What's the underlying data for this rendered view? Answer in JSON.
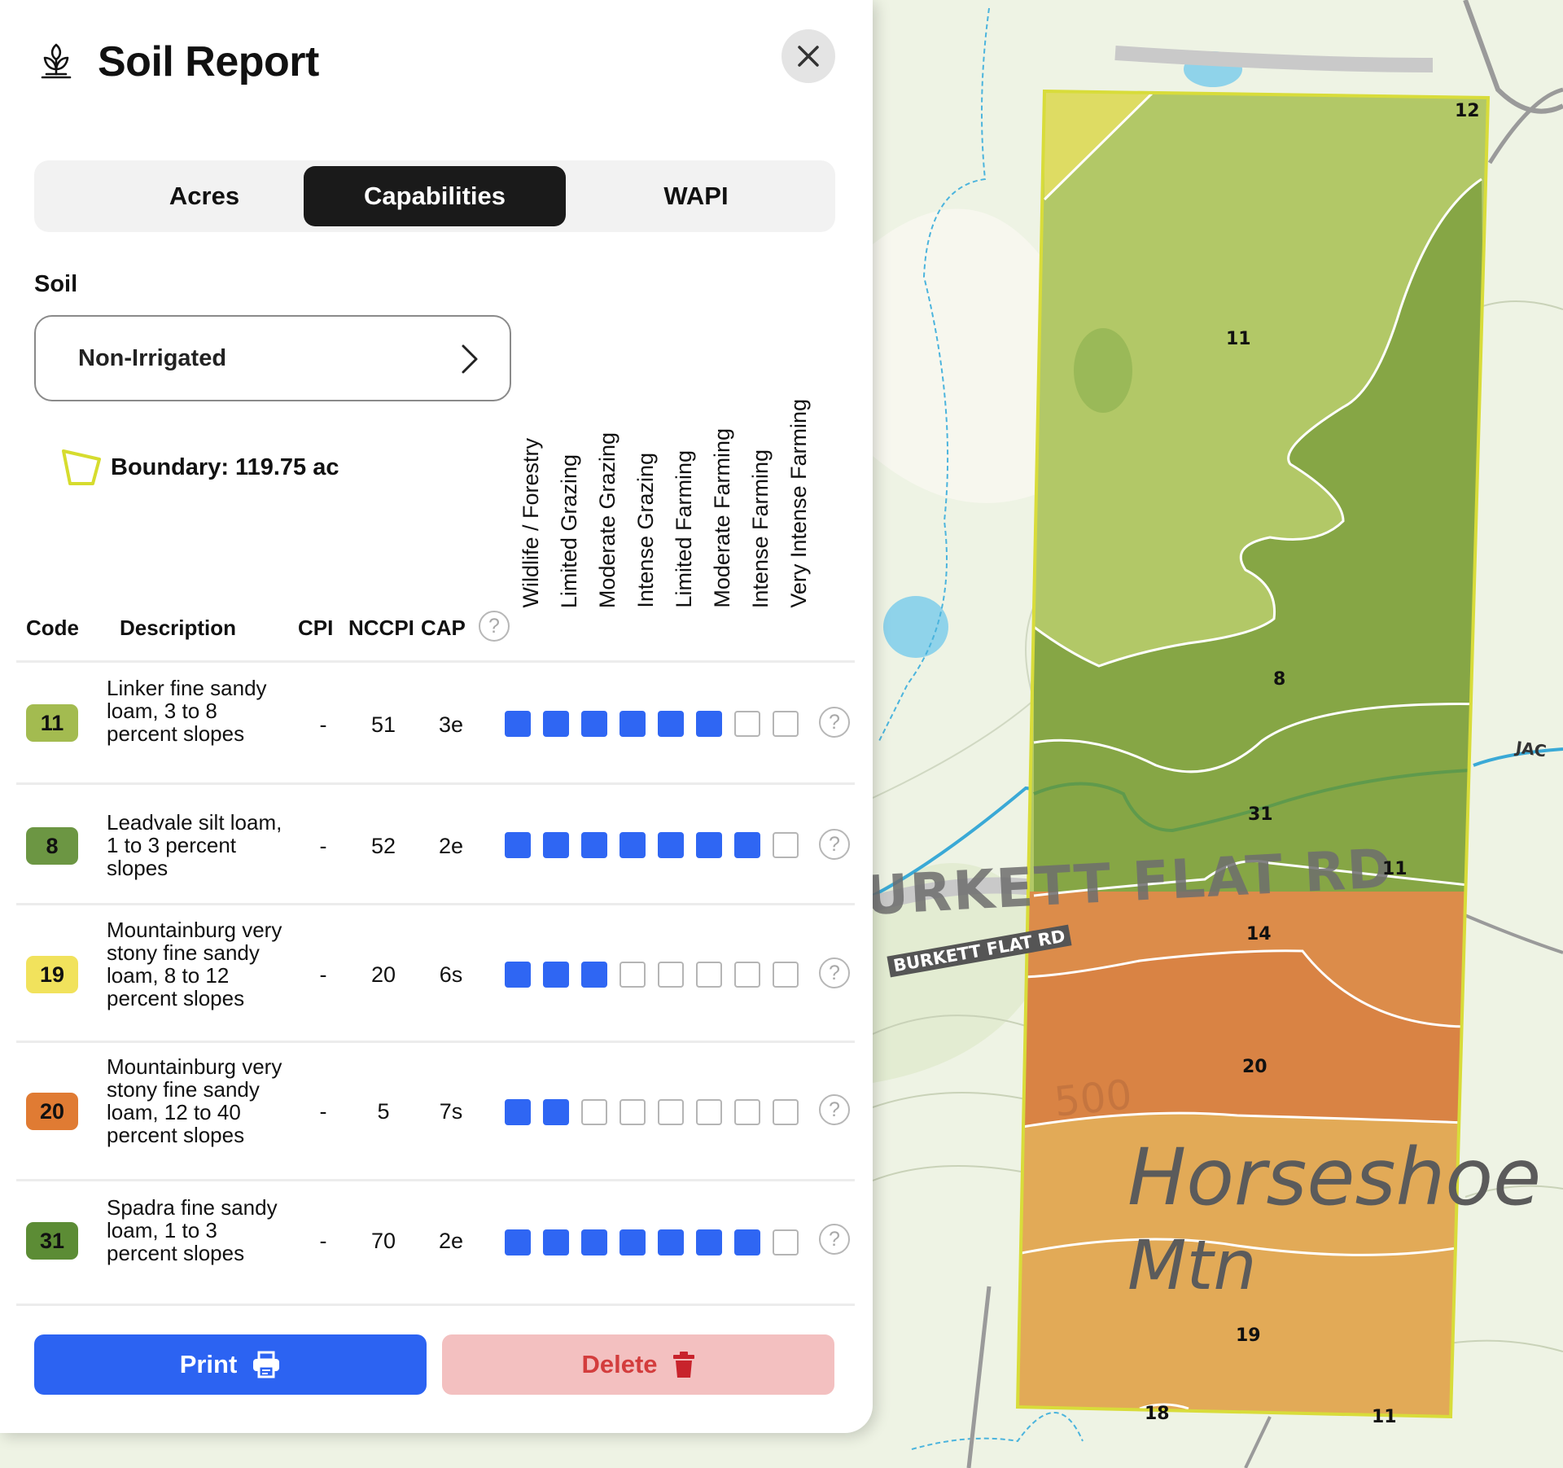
{
  "header": {
    "title": "Soil Report"
  },
  "tabs": [
    {
      "label": "Acres",
      "active": false
    },
    {
      "label": "Capabilities",
      "active": true
    },
    {
      "label": "WAPI",
      "active": false
    }
  ],
  "soil": {
    "label": "Soil",
    "selected": "Non-Irrigated"
  },
  "boundary": {
    "label": "Boundary: 119.75 ac"
  },
  "table": {
    "headers": {
      "code": "Code",
      "description": "Description",
      "cpi": "CPI",
      "nccpi": "NCCPI",
      "cap": "CAP"
    },
    "capability_columns": [
      "Wildlife / Forestry",
      "Limited Grazing",
      "Moderate Grazing",
      "Intense Grazing",
      "Limited Farming",
      "Moderate Farming",
      "Intense Farming",
      "Very Intense Farming"
    ],
    "rows": [
      {
        "code": "11",
        "color": "#a3bb50",
        "description": "Linker fine sandy loam, 3 to 8 percent slopes",
        "cpi": "-",
        "nccpi": "51",
        "cap": "3e",
        "capability_level": 6
      },
      {
        "code": "8",
        "color": "#6c9643",
        "description": "Leadvale silt loam, 1 to 3 percent slopes",
        "cpi": "-",
        "nccpi": "52",
        "cap": "2e",
        "capability_level": 7
      },
      {
        "code": "19",
        "color": "#f1e25c",
        "description": "Mountainburg very stony fine sandy loam, 8 to 12 percent slopes",
        "cpi": "-",
        "nccpi": "20",
        "cap": "6s",
        "capability_level": 3
      },
      {
        "code": "20",
        "color": "#e07b33",
        "description": "Mountainburg very stony fine sandy loam, 12 to 40 percent slopes",
        "cpi": "-",
        "nccpi": "5",
        "cap": "7s",
        "capability_level": 2
      },
      {
        "code": "31",
        "color": "#5c8c35",
        "description": "Spadra fine sandy loam, 1 to 3 percent slopes",
        "cpi": "-",
        "nccpi": "70",
        "cap": "2e",
        "capability_level": 7
      }
    ]
  },
  "actions": {
    "print_label": "Print",
    "delete_label": "Delete"
  },
  "map": {
    "road_label_large": "URKETT FLAT RD",
    "road_label_small": "BURKETT FLAT RD",
    "road_label_right": "JAC",
    "place_label_1": "Horseshoe",
    "place_label_2": "Mtn",
    "elevation_label": "500",
    "zone_labels": [
      "12",
      "11",
      "8",
      "31",
      "11",
      "14",
      "20",
      "19",
      "18",
      "11"
    ]
  },
  "icons": {
    "logo": "plant-icon",
    "close": "close-icon",
    "chevron": "chevron-right-icon",
    "boundary": "polygon-icon",
    "print": "printer-icon",
    "delete": "trash-icon",
    "help": "help-icon"
  },
  "colors": {
    "accent": "#2c63f2",
    "delete_bg": "#f3c0c0",
    "delete_text": "#d33d3d",
    "capability_on": "#2f66f3",
    "boundary": "#d8dc3a"
  }
}
